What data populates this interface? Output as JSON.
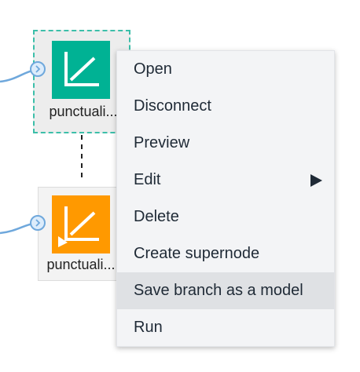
{
  "nodes": [
    {
      "label": "punctuali...",
      "color": "#00b294",
      "icon": "chart-icon"
    },
    {
      "label": "punctuali...",
      "color": "#ff9900",
      "icon": "chart-icon"
    }
  ],
  "colors": {
    "link": "#6fa8dc",
    "selection": "#3cbfa9"
  },
  "context_menu": {
    "items": [
      {
        "label": "Open"
      },
      {
        "label": "Disconnect"
      },
      {
        "label": "Preview"
      },
      {
        "label": "Edit",
        "has_submenu": true
      },
      {
        "label": "Delete"
      },
      {
        "label": "Create supernode"
      },
      {
        "label": "Save branch as a model",
        "highlighted": true
      },
      {
        "label": "Run"
      }
    ]
  }
}
